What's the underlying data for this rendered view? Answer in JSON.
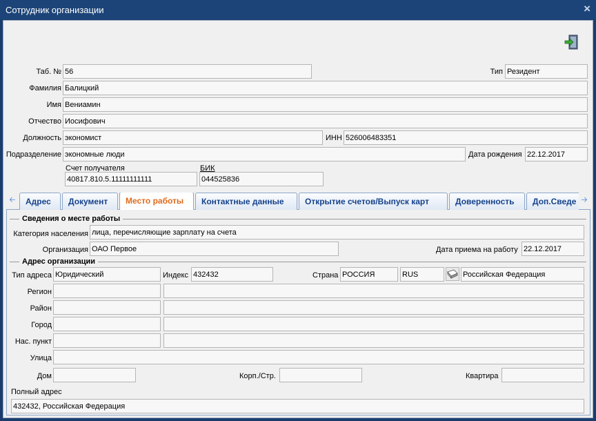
{
  "window": {
    "title": "Сотрудник организации",
    "close_glyph": "×"
  },
  "header": {
    "tab_no_label": "Таб. №",
    "tab_no": "56",
    "type_label": "Тип",
    "type": "Резидент",
    "surname_label": "Фамилия",
    "surname": "Балицкий",
    "name_label": "Имя",
    "name": "Вениамин",
    "patronymic_label": "Отчество",
    "patronymic": "Иосифович",
    "position_label": "Должность",
    "position": "экономист",
    "inn_label": "ИНН",
    "inn": "526006483351",
    "department_label": "Подразделение",
    "department": "экономные люди",
    "birth_label": "Дата рождения",
    "birth": "22.12.2017",
    "account_label": "Счет получателя",
    "account": "40817.810.5.11111111111",
    "bik_label": "БИК",
    "bik": "044525836"
  },
  "tabs": [
    {
      "label": "Адрес"
    },
    {
      "label": "Документ"
    },
    {
      "label": "Место работы"
    },
    {
      "label": "Контактные данные"
    },
    {
      "label": "Открытие счетов/Выпуск карт"
    },
    {
      "label": "Доверенность"
    },
    {
      "label": "Доп.Сведе"
    }
  ],
  "work": {
    "section_title": "Сведения о месте работы",
    "category_label": "Категория населения",
    "category": "лица, перечисляющие зарплату на счета",
    "org_label": "Организация",
    "org": "ОАО Первое",
    "hire_label": "Дата приема на работу",
    "hire": "22.12.2017"
  },
  "address": {
    "section_title": "Адрес организации",
    "type_label": "Тип адреса",
    "type": "Юридический",
    "index_label": "Индекс",
    "index": "432432",
    "country_label": "Страна",
    "country": "РОССИЯ",
    "country_code": "RUS",
    "country_full": "Российская Федерация",
    "region_label": "Регион",
    "district_label": "Район",
    "city_label": "Город",
    "settlement_label": "Нас. пункт",
    "street_label": "Улица",
    "house_label": "Дом",
    "building_label": "Корп./Стр.",
    "flat_label": "Квартира",
    "full_label": "Полный адрес",
    "full": "432432, Российская Федерация"
  }
}
